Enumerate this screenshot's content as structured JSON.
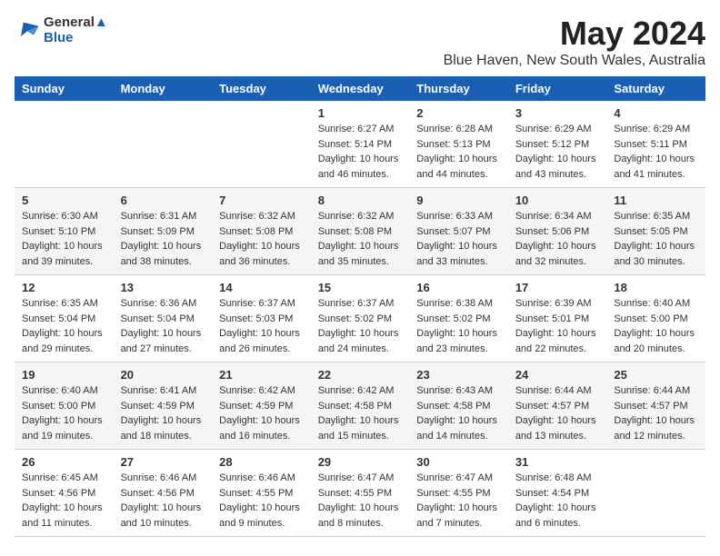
{
  "header": {
    "logo_line1": "General",
    "logo_line2": "Blue",
    "month_title": "May 2024",
    "location": "Blue Haven, New South Wales, Australia"
  },
  "days_of_week": [
    "Sunday",
    "Monday",
    "Tuesday",
    "Wednesday",
    "Thursday",
    "Friday",
    "Saturday"
  ],
  "weeks": [
    [
      {
        "day": "",
        "info": ""
      },
      {
        "day": "",
        "info": ""
      },
      {
        "day": "",
        "info": ""
      },
      {
        "day": "1",
        "info": "Sunrise: 6:27 AM\nSunset: 5:14 PM\nDaylight: 10 hours\nand 46 minutes."
      },
      {
        "day": "2",
        "info": "Sunrise: 6:28 AM\nSunset: 5:13 PM\nDaylight: 10 hours\nand 44 minutes."
      },
      {
        "day": "3",
        "info": "Sunrise: 6:29 AM\nSunset: 5:12 PM\nDaylight: 10 hours\nand 43 minutes."
      },
      {
        "day": "4",
        "info": "Sunrise: 6:29 AM\nSunset: 5:11 PM\nDaylight: 10 hours\nand 41 minutes."
      }
    ],
    [
      {
        "day": "5",
        "info": "Sunrise: 6:30 AM\nSunset: 5:10 PM\nDaylight: 10 hours\nand 39 minutes."
      },
      {
        "day": "6",
        "info": "Sunrise: 6:31 AM\nSunset: 5:09 PM\nDaylight: 10 hours\nand 38 minutes."
      },
      {
        "day": "7",
        "info": "Sunrise: 6:32 AM\nSunset: 5:08 PM\nDaylight: 10 hours\nand 36 minutes."
      },
      {
        "day": "8",
        "info": "Sunrise: 6:32 AM\nSunset: 5:08 PM\nDaylight: 10 hours\nand 35 minutes."
      },
      {
        "day": "9",
        "info": "Sunrise: 6:33 AM\nSunset: 5:07 PM\nDaylight: 10 hours\nand 33 minutes."
      },
      {
        "day": "10",
        "info": "Sunrise: 6:34 AM\nSunset: 5:06 PM\nDaylight: 10 hours\nand 32 minutes."
      },
      {
        "day": "11",
        "info": "Sunrise: 6:35 AM\nSunset: 5:05 PM\nDaylight: 10 hours\nand 30 minutes."
      }
    ],
    [
      {
        "day": "12",
        "info": "Sunrise: 6:35 AM\nSunset: 5:04 PM\nDaylight: 10 hours\nand 29 minutes."
      },
      {
        "day": "13",
        "info": "Sunrise: 6:36 AM\nSunset: 5:04 PM\nDaylight: 10 hours\nand 27 minutes."
      },
      {
        "day": "14",
        "info": "Sunrise: 6:37 AM\nSunset: 5:03 PM\nDaylight: 10 hours\nand 26 minutes."
      },
      {
        "day": "15",
        "info": "Sunrise: 6:37 AM\nSunset: 5:02 PM\nDaylight: 10 hours\nand 24 minutes."
      },
      {
        "day": "16",
        "info": "Sunrise: 6:38 AM\nSunset: 5:02 PM\nDaylight: 10 hours\nand 23 minutes."
      },
      {
        "day": "17",
        "info": "Sunrise: 6:39 AM\nSunset: 5:01 PM\nDaylight: 10 hours\nand 22 minutes."
      },
      {
        "day": "18",
        "info": "Sunrise: 6:40 AM\nSunset: 5:00 PM\nDaylight: 10 hours\nand 20 minutes."
      }
    ],
    [
      {
        "day": "19",
        "info": "Sunrise: 6:40 AM\nSunset: 5:00 PM\nDaylight: 10 hours\nand 19 minutes."
      },
      {
        "day": "20",
        "info": "Sunrise: 6:41 AM\nSunset: 4:59 PM\nDaylight: 10 hours\nand 18 minutes."
      },
      {
        "day": "21",
        "info": "Sunrise: 6:42 AM\nSunset: 4:59 PM\nDaylight: 10 hours\nand 16 minutes."
      },
      {
        "day": "22",
        "info": "Sunrise: 6:42 AM\nSunset: 4:58 PM\nDaylight: 10 hours\nand 15 minutes."
      },
      {
        "day": "23",
        "info": "Sunrise: 6:43 AM\nSunset: 4:58 PM\nDaylight: 10 hours\nand 14 minutes."
      },
      {
        "day": "24",
        "info": "Sunrise: 6:44 AM\nSunset: 4:57 PM\nDaylight: 10 hours\nand 13 minutes."
      },
      {
        "day": "25",
        "info": "Sunrise: 6:44 AM\nSunset: 4:57 PM\nDaylight: 10 hours\nand 12 minutes."
      }
    ],
    [
      {
        "day": "26",
        "info": "Sunrise: 6:45 AM\nSunset: 4:56 PM\nDaylight: 10 hours\nand 11 minutes."
      },
      {
        "day": "27",
        "info": "Sunrise: 6:46 AM\nSunset: 4:56 PM\nDaylight: 10 hours\nand 10 minutes."
      },
      {
        "day": "28",
        "info": "Sunrise: 6:46 AM\nSunset: 4:55 PM\nDaylight: 10 hours\nand 9 minutes."
      },
      {
        "day": "29",
        "info": "Sunrise: 6:47 AM\nSunset: 4:55 PM\nDaylight: 10 hours\nand 8 minutes."
      },
      {
        "day": "30",
        "info": "Sunrise: 6:47 AM\nSunset: 4:55 PM\nDaylight: 10 hours\nand 7 minutes."
      },
      {
        "day": "31",
        "info": "Sunrise: 6:48 AM\nSunset: 4:54 PM\nDaylight: 10 hours\nand 6 minutes."
      },
      {
        "day": "",
        "info": ""
      }
    ]
  ]
}
